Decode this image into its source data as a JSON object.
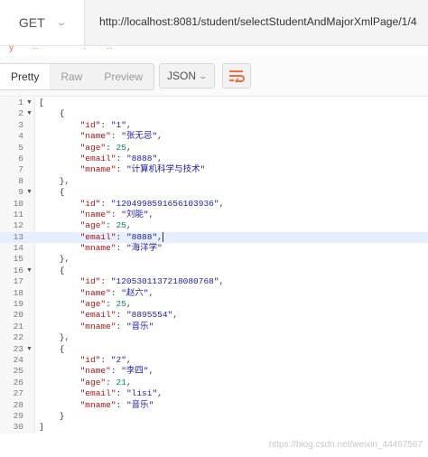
{
  "request": {
    "method": "GET",
    "url": "http://localhost:8081/student/selectStudentAndMajorXmlPage/1/4"
  },
  "response_tabs_partial": [
    "y",
    "··",
    "·",
    "··"
  ],
  "toolbar": {
    "views": [
      "Pretty",
      "Raw",
      "Preview"
    ],
    "active_view": "Pretty",
    "format": "JSON",
    "icons": [
      "chevron-down-icon",
      "wrap-lines-icon"
    ]
  },
  "colors": {
    "accent": "#f26b3a",
    "key": "#a31515",
    "string": "#1a1aa6",
    "number": "#098658",
    "highlight": "#e6efff"
  },
  "records": [
    {
      "id": "1",
      "name": "张无忌",
      "age": 25,
      "email": "8888",
      "mname": "计算机科学与技术"
    },
    {
      "id": "1204998591656103936",
      "name": "刘能",
      "age": 25,
      "email": "8888",
      "mname": "海洋学"
    },
    {
      "id": "1205301137218080768",
      "name": "赵六",
      "age": 25,
      "email": "8895554",
      "mname": "音乐"
    },
    {
      "id": "2",
      "name": "李四",
      "age": 21,
      "email": "lisi",
      "mname": "音乐"
    }
  ],
  "highlighted_line": 13,
  "watermark": "https://blog.csdn.net/weixin_44467567"
}
